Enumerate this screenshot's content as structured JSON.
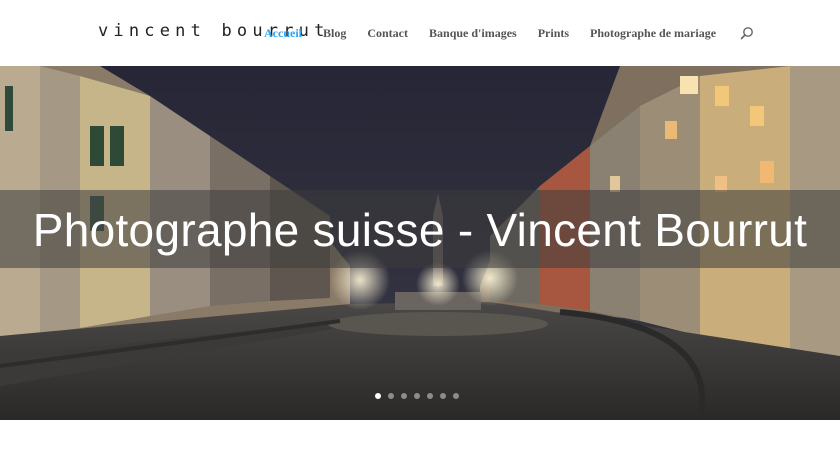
{
  "header": {
    "logo_text": "vincent bourrut",
    "nav": [
      {
        "label": "Accueil",
        "active": true
      },
      {
        "label": "Blog",
        "active": false
      },
      {
        "label": "Contact",
        "active": false
      },
      {
        "label": "Banque d'images",
        "active": false
      },
      {
        "label": "Prints",
        "active": false
      },
      {
        "label": "Photographe de mariage",
        "active": false
      }
    ],
    "search_icon": "search-icon"
  },
  "hero": {
    "title": "Photographe suisse - Vincent Bourrut",
    "slide_count": 7,
    "active_slide": 1
  },
  "colors": {
    "accent": "#2ea3f2",
    "nav_text": "#555555",
    "hero_band": "rgba(60,60,60,0.55)"
  }
}
